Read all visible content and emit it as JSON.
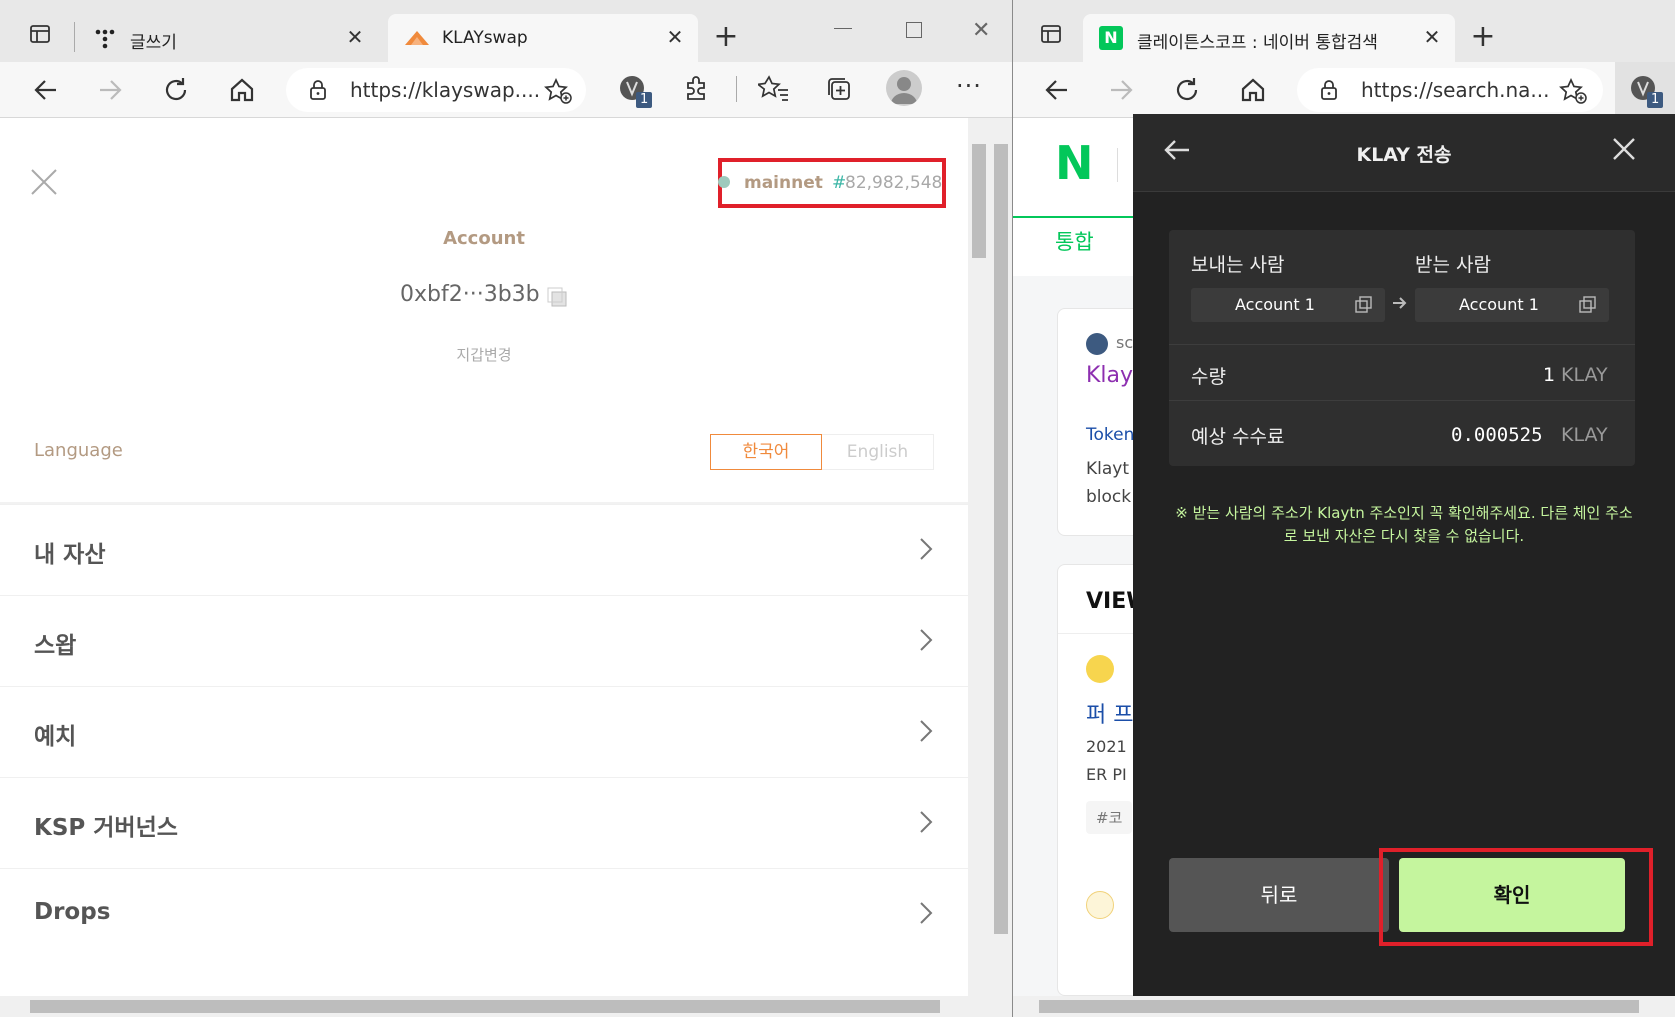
{
  "left_window": {
    "tabs": [
      {
        "title": "글쓰기",
        "active": false
      },
      {
        "title": "KLAYswap",
        "active": true
      }
    ],
    "url": "https://klayswap....",
    "extension_badge": "1",
    "page": {
      "network": "mainnet",
      "block_hash": "#",
      "block_number": "82,982,548",
      "account_label": "Account",
      "address": "0xbf2···3b3b",
      "change_wallet": "지갑변경",
      "language_label": "Language",
      "lang_korean": "한국어",
      "lang_english": "English",
      "menu": [
        "내 자산",
        "스왑",
        "예치",
        "KSP 거버넌스",
        "Drops"
      ]
    }
  },
  "right_window": {
    "tabs": [
      {
        "title": "클레이튼스코프 : 네이버 통합검색",
        "active": true
      }
    ],
    "url": "https://search.na...",
    "extension_badge": "1",
    "naver": {
      "logo": "N",
      "tab_integrated": "통합",
      "card1_site": "sc",
      "card1_title": "Klay",
      "card1_link": "Token",
      "card1_text1": "Klayt",
      "card1_text2": "block",
      "section_view": "VIEW",
      "card2_title": "퍼 프",
      "card2_text1": "2021",
      "card2_text2": "ER PI",
      "card2_tag": "#코"
    },
    "wallet": {
      "title": "KLAY 전송",
      "sender_label": "보내는 사람",
      "receiver_label": "받는 사람",
      "sender_account": "Account 1",
      "receiver_account": "Account 1",
      "amount_label": "수량",
      "amount_value": "1",
      "amount_unit": "KLAY",
      "fee_label": "예상 수수료",
      "fee_value": "0.000525",
      "fee_unit": "KLAY",
      "warning": "※ 받는 사람의 주소가 Klaytn 주소인지 꼭 확인해주세요. 다른 체인 주소로 보낸 자산은 다시 찾을 수 없습니다.",
      "back_button": "뒤로",
      "confirm_button": "확인"
    }
  },
  "colors": {
    "highlight_red": "#e0202a",
    "klayswap_brown": "#b39a82",
    "lang_orange": "#f08a3c",
    "naver_green": "#03c75a",
    "wallet_green": "#c5f59e",
    "wallet_bg": "#222222"
  }
}
